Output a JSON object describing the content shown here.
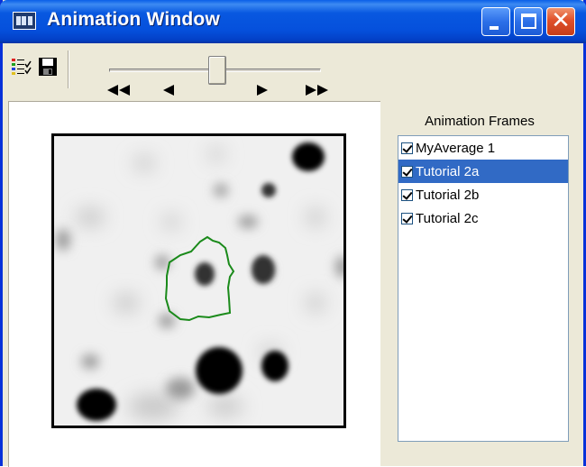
{
  "window": {
    "title": "Animation Window",
    "icon": "film-strip-icon"
  },
  "titlebar_buttons": [
    "minimize-icon",
    "maximize-icon",
    "close-icon"
  ],
  "toolbar": {
    "buttons": [
      "frame-list-icon",
      "save-disk-icon"
    ],
    "playback": [
      "first-frame-icon",
      "previous-frame-icon",
      "next-frame-icon",
      "last-frame-icon"
    ],
    "slider_position": 0.5
  },
  "frames_panel": {
    "label": "Animation Frames",
    "items": [
      {
        "label": "MyAverage 1",
        "checked": true,
        "selected": false
      },
      {
        "label": "Tutorial 2a",
        "checked": true,
        "selected": true
      },
      {
        "label": "Tutorial 2b",
        "checked": true,
        "selected": false
      },
      {
        "label": "Tutorial 2c",
        "checked": true,
        "selected": false
      }
    ]
  },
  "colors": {
    "titlebar": "#0550dc",
    "selection": "#316ac5",
    "region_outline": "#1a8a1a"
  }
}
